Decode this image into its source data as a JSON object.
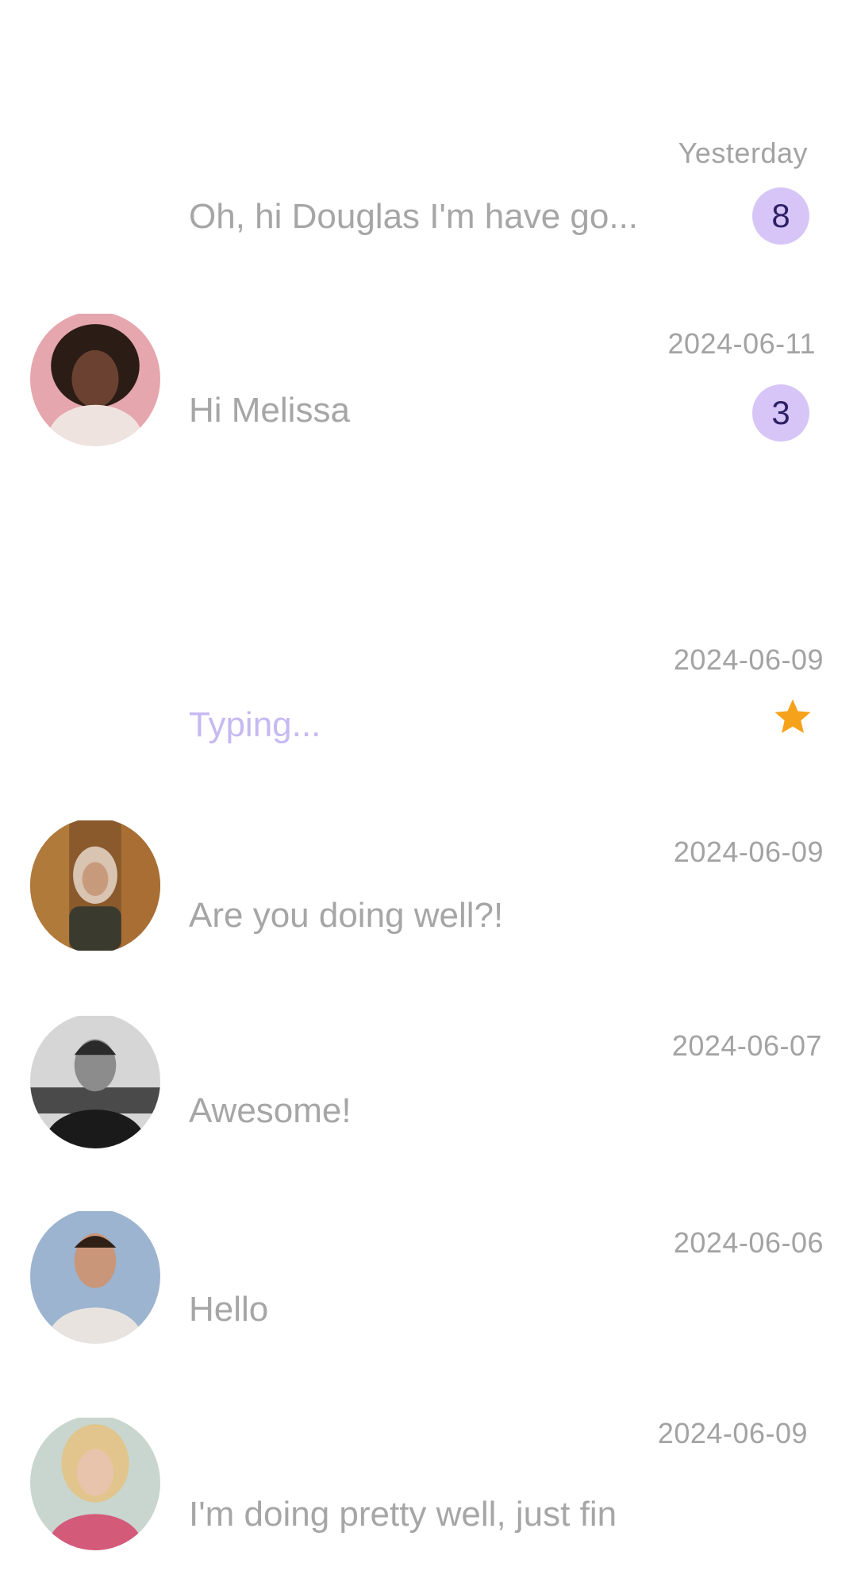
{
  "accent_color": "#d7c5f8",
  "star_color": "#f7a21b",
  "conversations": [
    {
      "date": "Yesterday",
      "message": "Oh, hi Douglas I'm have go...",
      "unread": "8",
      "avatar": "none"
    },
    {
      "date": "2024-06-11",
      "message": "Hi Melissa",
      "unread": "3",
      "avatar": "woman-curly-hair-pink"
    },
    {
      "date": "2024-06-09",
      "message": "Typing...",
      "starred": true,
      "avatar": "none"
    },
    {
      "date": "2024-06-09",
      "message": "Are you doing well?!",
      "avatar": "woman-hijab-cafe"
    },
    {
      "date": "2024-06-07",
      "message": "Awesome!",
      "avatar": "man-black-white"
    },
    {
      "date": "2024-06-06",
      "message": "Hello",
      "avatar": "man-tank-top-blue"
    },
    {
      "date": "2024-06-09",
      "message": "I'm doing pretty well, just fin",
      "avatar": "woman-blonde"
    }
  ]
}
